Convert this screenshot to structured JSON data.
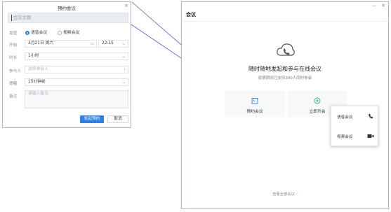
{
  "dialog": {
    "title": "预约会议",
    "subject_placeholder": "会议主题",
    "type": {
      "label": "类型",
      "options": [
        "语音会议",
        "视频会议"
      ],
      "selected": 0
    },
    "start": {
      "label": "开始",
      "date": "3月21日 周六",
      "time": "22:15"
    },
    "duration": {
      "label": "时长",
      "value": "1小时"
    },
    "participants": {
      "label": "参与人",
      "placeholder": "选择参会人"
    },
    "reminder": {
      "label": "提醒",
      "value": "15分钟前"
    },
    "notes": {
      "label": "备注",
      "placeholder": "请输入备注"
    },
    "submit_label": "发起预约",
    "cancel_label": "取消"
  },
  "window": {
    "title": "会议",
    "hero_title": "随时随地发起和参与在线会议",
    "hero_subtitle": "疫情期间已支持300人同时参会",
    "cards": [
      {
        "label": "预约会议",
        "icon": "calendar-icon"
      },
      {
        "label": "立即开会",
        "icon": "plus-circle-icon"
      }
    ],
    "start_menu": [
      {
        "label": "语音会议",
        "icon": "phone-icon"
      },
      {
        "label": "视频会议",
        "icon": "video-camera-icon"
      }
    ],
    "footer_link": "查看全部会议 ›"
  },
  "colors": {
    "accent": "#2f7fe0",
    "connector": "#5a5fd6"
  }
}
